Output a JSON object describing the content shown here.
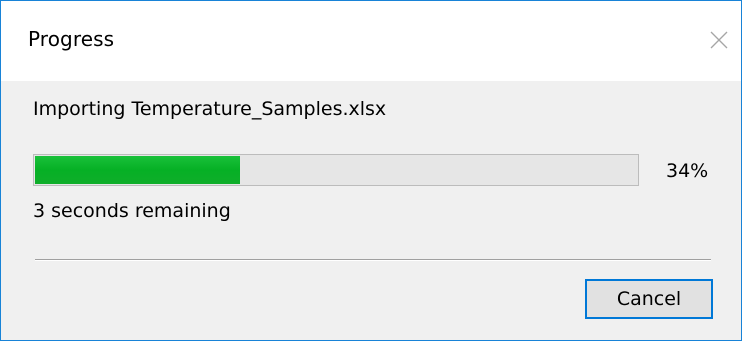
{
  "dialog": {
    "title": "Progress",
    "close_icon": "close-icon",
    "message": "Importing Temperature_Samples.xlsx",
    "progress": {
      "percent_value": 34,
      "percent_label": "34%",
      "fill_color": "#06b025"
    },
    "time_remaining": "3 seconds remaining",
    "cancel_label": "Cancel",
    "accent_color": "#0078d7"
  }
}
